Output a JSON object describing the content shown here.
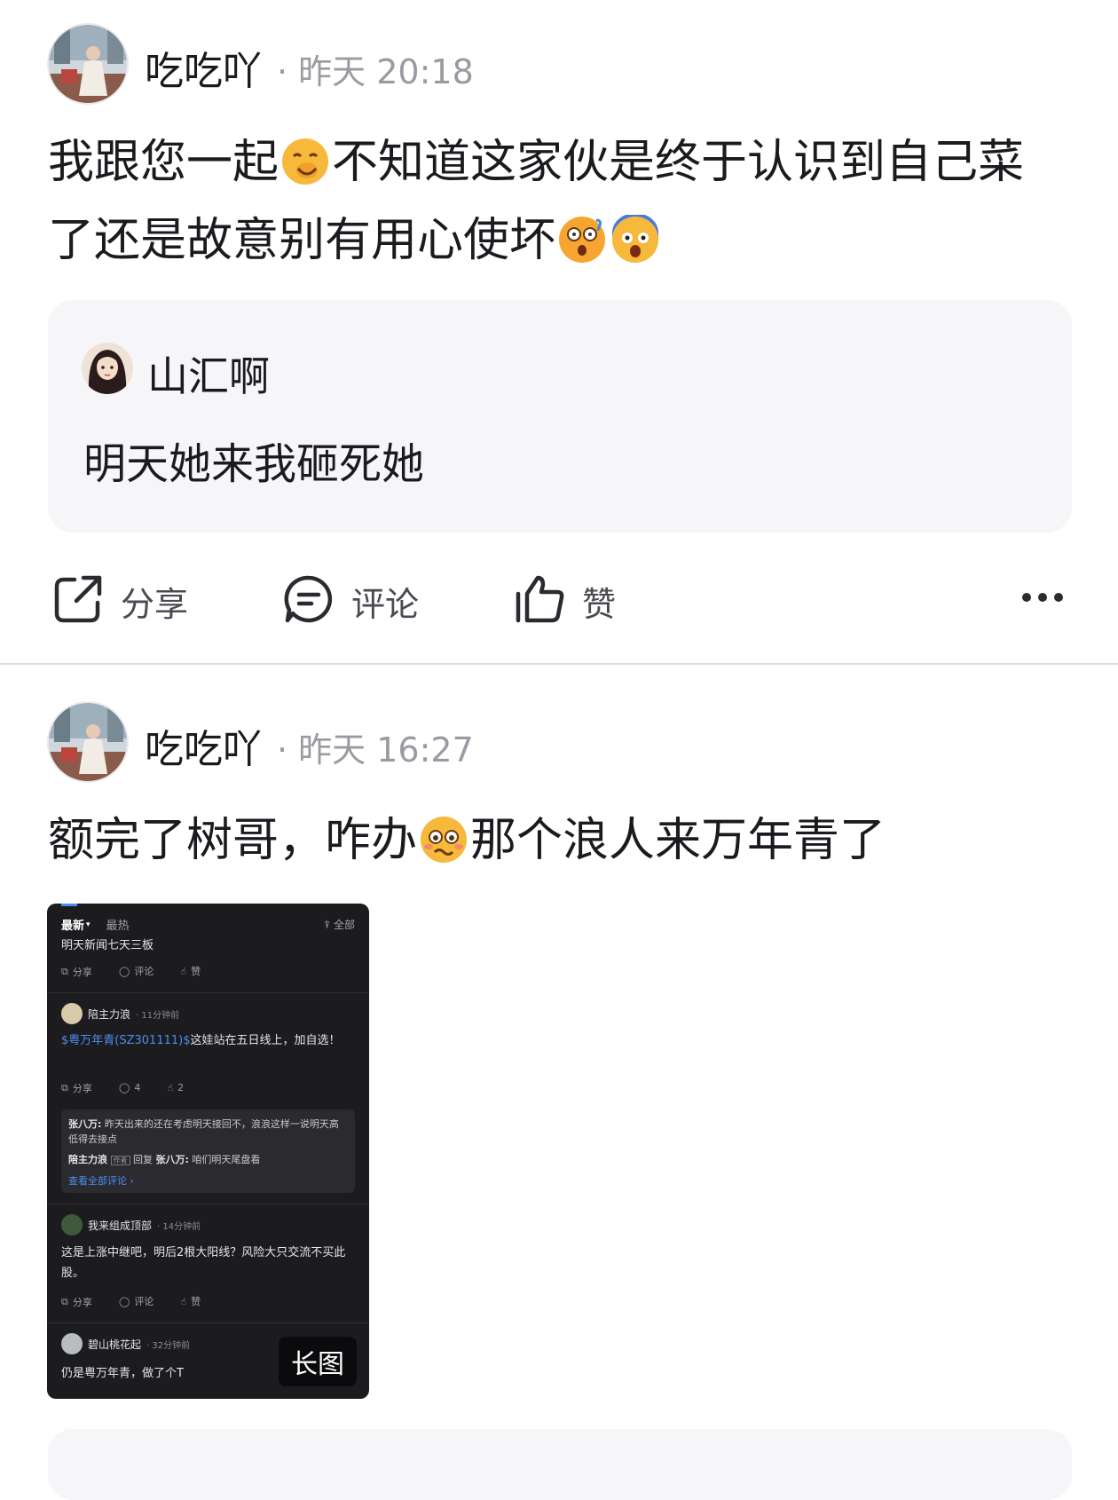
{
  "post1": {
    "username": "吃吃吖",
    "time": "· 昨天 20:18",
    "text_a": "我跟您一起",
    "text_b": "不知道这家伙是终于认识到自己菜了还是故意别有用心使坏",
    "quote": {
      "username": "山汇啊",
      "text": "明天她来我砸死她"
    }
  },
  "actions": {
    "share": "分享",
    "comment": "评论",
    "like": "赞"
  },
  "post2": {
    "username": "吃吃吖",
    "time": "· 昨天 16:27",
    "text_a": "额完了树哥，咋办",
    "text_b": "那个浪人来万年青了"
  },
  "thumbnail": {
    "tab_latest": "最新",
    "tab_hot": "最热",
    "filter": "全部",
    "top_text": "明天新闻七天三板",
    "share": "分享",
    "comment": "评论",
    "like": "赞",
    "c1_user": "陪主力浪",
    "c1_time": "· 11分钟前",
    "c1_link": "$粤万年青(SZ301111)$",
    "c1_text": "这娃站在五日线上，加自选！",
    "c1_comments": "4",
    "c1_likes": "2",
    "reply1_user": "张八万:",
    "reply1_text": "昨天出来的还在考虑明天接回不，浪浪这样一说明天高低得去接点",
    "reply2_user": "陪主力浪",
    "reply2_badge": "作者",
    "reply2_mid": "回复",
    "reply2_target": "张八万:",
    "reply2_text": "咱们明天尾盘看",
    "view_all": "查看全部评论 ›",
    "c2_user": "我来组成顶部",
    "c2_time": "· 14分钟前",
    "c2_text": "这是上涨中继吧，明后2根大阳线？风险大只交流不买此股。",
    "c3_user": "碧山桃花起",
    "c3_time": "· 32分钟前",
    "c3_text": "仍是粤万年青，做了个T",
    "long_image_label": "长图"
  }
}
